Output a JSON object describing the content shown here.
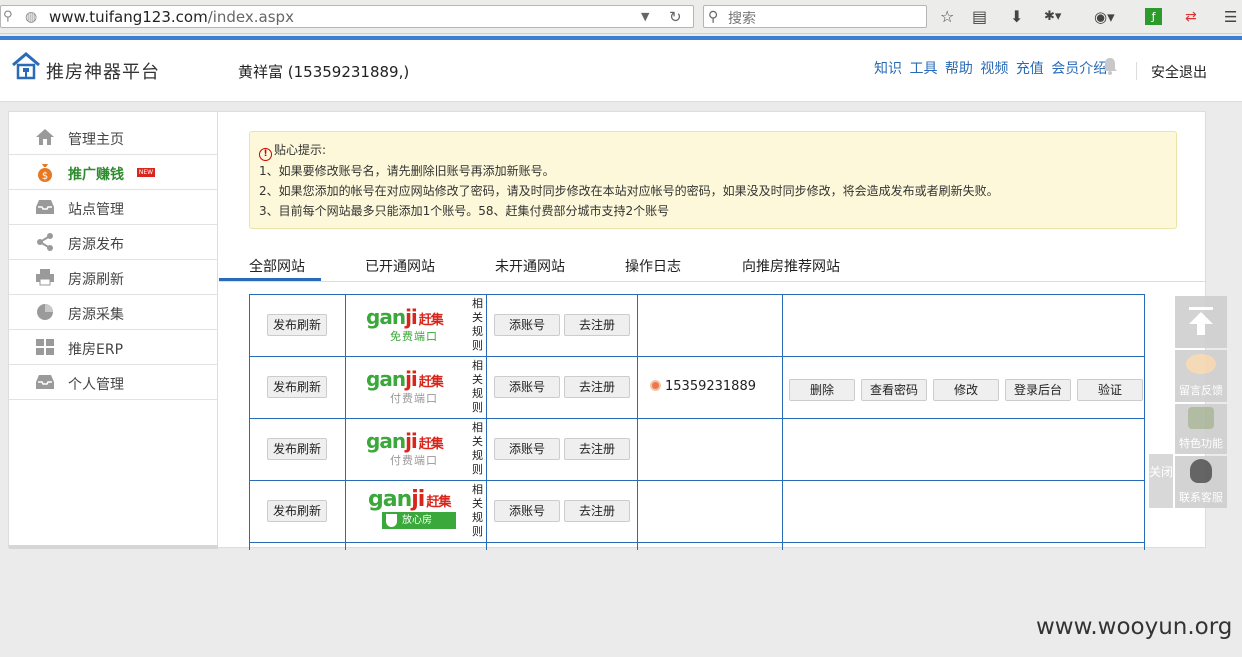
{
  "browser": {
    "url_domain": "www.tuifang123.com",
    "url_path": "/index.aspx",
    "search_placeholder": "搜索"
  },
  "header": {
    "logo": "推房神器平台",
    "user": "黄祥富 (15359231889,)",
    "links": [
      "知识",
      "工具",
      "帮助",
      "视频",
      "充值",
      "会员介绍"
    ],
    "logout": "安全退出"
  },
  "sidebar": {
    "items": [
      {
        "label": "管理主页",
        "icon": "home-icon"
      },
      {
        "label": "推广赚钱",
        "icon": "money-bag-icon",
        "badge": "NEW"
      },
      {
        "label": "站点管理",
        "icon": "inbox-icon"
      },
      {
        "label": "房源发布",
        "icon": "share-icon"
      },
      {
        "label": "房源刷新",
        "icon": "printer-icon"
      },
      {
        "label": "房源采集",
        "icon": "pie-icon"
      },
      {
        "label": "推房ERP",
        "icon": "grid-icon"
      },
      {
        "label": "个人管理",
        "icon": "inbox-icon"
      }
    ]
  },
  "notice": {
    "title": "贴心提示:",
    "lines": [
      "1、如果要修改账号名，请先删除旧账号再添加新账号。",
      "2、如果您添加的帐号在对应网站修改了密码，请及时同步修改在本站对应帐号的密码，如果没及时同步修改，将会造成发布或者刷新失败。",
      "3、目前每个网站最多只能添加1个账号。58、赶集付费部分城市支持2个账号"
    ]
  },
  "tabs": [
    "全部网站",
    "已开通网站",
    "未开通网站",
    "操作日志",
    "向推房推荐网站"
  ],
  "table": {
    "rows": [
      {
        "publish": "发布刷新",
        "logo": "ganji",
        "logo_label": "赶集",
        "sub": "免费端口",
        "rules": "相关规则",
        "add": "添账号",
        "register": "去注册",
        "account": "",
        "actions": []
      },
      {
        "publish": "发布刷新",
        "logo": "ganji",
        "logo_label": "赶集",
        "sub": "付费端口",
        "rules": "相关规则",
        "add": "添账号",
        "register": "去注册",
        "account": "15359231889",
        "actions": [
          "删除",
          "查看密码",
          "修改",
          "登录后台",
          "验证"
        ]
      },
      {
        "publish": "发布刷新",
        "logo": "ganji",
        "logo_label": "赶集",
        "sub": "付费端口",
        "rules": "相关规则",
        "add": "添账号",
        "register": "去注册",
        "account": "",
        "actions": []
      },
      {
        "publish": "发布刷新",
        "logo": "ganji",
        "logo_label": "赶集",
        "sub": "放心房",
        "rules": "相关规则",
        "add": "添账号",
        "register": "去注册",
        "account": "",
        "actions": []
      }
    ]
  },
  "float": {
    "feedback": "留言反馈",
    "features": "特色功能",
    "support": "联系客服",
    "close": "关闭"
  },
  "watermark": "www.wooyun.org"
}
